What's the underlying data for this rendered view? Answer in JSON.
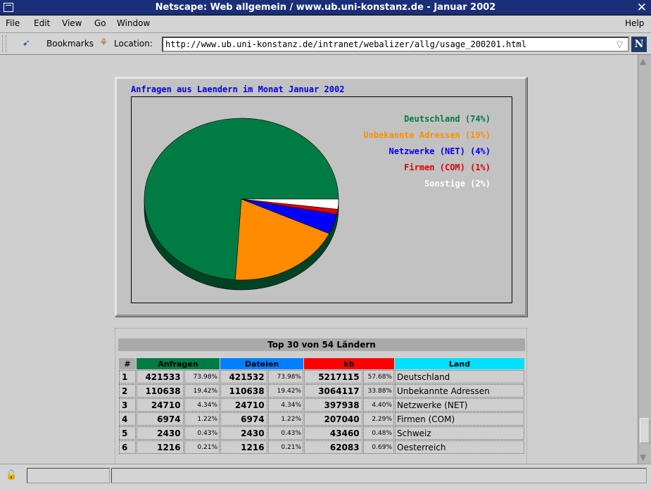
{
  "window": {
    "title": "Netscape: Web allgemein / www.ub.uni-konstanz.de - Januar 2002"
  },
  "menu": {
    "items": [
      "File",
      "Edit",
      "View",
      "Go",
      "Window"
    ],
    "help": "Help"
  },
  "toolbar": {
    "bookmarks_label": "Bookmarks",
    "location_label": "Location:",
    "url": "http://www.ub.uni-konstanz.de/intranet/webalizer/allg/usage_200201.html"
  },
  "chart_data": {
    "type": "pie",
    "title": "Anfragen aus Laendern im Monat Januar 2002",
    "series": [
      {
        "name": "Deutschland (74%)",
        "value": 74,
        "color": "#007b43"
      },
      {
        "name": "Unbekannte Adressen (19%)",
        "value": 19,
        "color": "#ff8c00"
      },
      {
        "name": "Netzwerke (NET) (4%)",
        "value": 4,
        "color": "#0000ff"
      },
      {
        "name": "Firmen (COM) (1%)",
        "value": 1,
        "color": "#e00000"
      },
      {
        "name": "Sonstige (2%)",
        "value": 2,
        "color": "#ffffff"
      }
    ],
    "legend": "right"
  },
  "table": {
    "title": "Top 30 von 54 Ländern",
    "headers": [
      "#",
      "Anfragen",
      "Dateien",
      "kb",
      "Land"
    ],
    "header_colors": [
      "#a9a9a9",
      "#007b43",
      "#0080ff",
      "#ff0000",
      "#00e0ff"
    ],
    "rows": [
      [
        "1",
        "421533",
        "73.98%",
        "421532",
        "73.98%",
        "5217115",
        "57.68%",
        "Deutschland"
      ],
      [
        "2",
        "110638",
        "19.42%",
        "110638",
        "19.42%",
        "3064117",
        "33.88%",
        "Unbekannte Adressen"
      ],
      [
        "3",
        "24710",
        "4.34%",
        "24710",
        "4.34%",
        "397938",
        "4.40%",
        "Netzwerke (NET)"
      ],
      [
        "4",
        "6974",
        "1.22%",
        "6974",
        "1.22%",
        "207040",
        "2.29%",
        "Firmen (COM)"
      ],
      [
        "5",
        "2430",
        "0.43%",
        "2430",
        "0.43%",
        "43460",
        "0.48%",
        "Schweiz"
      ],
      [
        "6",
        "1216",
        "0.21%",
        "1216",
        "0.21%",
        "62083",
        "0.69%",
        "Oesterreich"
      ]
    ]
  }
}
